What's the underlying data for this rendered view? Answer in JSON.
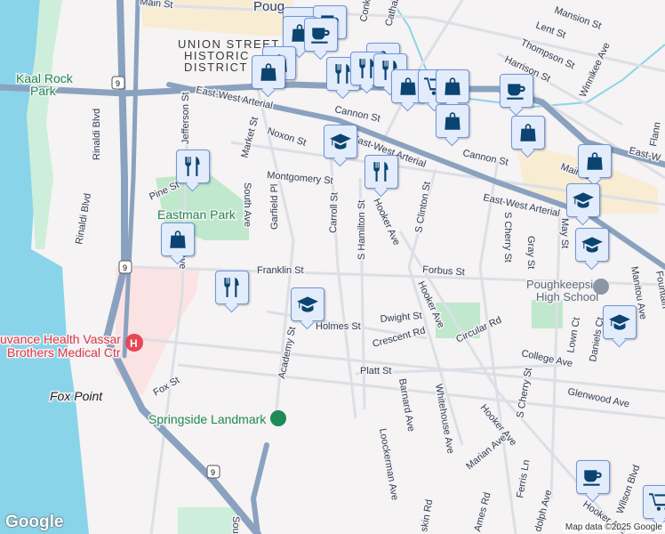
{
  "map": {
    "areas": {
      "district": [
        "UNION STREET",
        "HISTORIC",
        "DISTRICT"
      ],
      "city_partial": "Poug",
      "kaal_rock": [
        "Kaal Rock",
        "Park"
      ],
      "eastman": "Eastman Park",
      "hospital": [
        "uvance Health Vassar",
        "Brothers Medical Ctr"
      ],
      "fox_point": "Fox Point",
      "springside": "Springside Landmark",
      "high_school": [
        "Poughkeepsie",
        "High School"
      ]
    },
    "streets": {
      "main": "Main St",
      "main2": "Main St",
      "arterial1": "East-West Arterial",
      "arterial2": "East-West Arterial",
      "arterial3": "East-West Arterial",
      "arterial4": "East-W",
      "noxon": "Noxon St",
      "montgomery": "Montgomery St",
      "pine": "Pine St",
      "jefferson": "Jefferson St",
      "market": "Market St",
      "rinaldi1": "Rinaldi Blvd",
      "rinaldi2": "Rinaldi Blvd",
      "south_ave": "South Ave",
      "garfield": "Garfield Pl",
      "carroll": "Carroll St",
      "hamilton": "S Hamilton St",
      "hooker1": "Hooker Ave",
      "hooker2": "Hooker Ave",
      "hooker3": "Hooker Ave",
      "hooker4": "Hooker Ave",
      "clinton": "S Clinton St",
      "cannon1": "Cannon St",
      "cannon2": "Cannon St",
      "franklin": "Franklin St",
      "forbus": "Forbus St",
      "dwight": "Dwight St",
      "holmes": "Holmes St",
      "crescent": "Crescent Rd",
      "circular": "Circular Rd",
      "platt": "Platt St",
      "college": "College Ave",
      "glenwood": "Glenwood Ave",
      "barnard": "Barnard Ave",
      "whitehouse": "Whitehouse Ave",
      "loockerman": "Loockerman Ave",
      "marian": "Marian Ave",
      "ferris": "Ferris Ln",
      "academy": "Academy St",
      "fox": "Fox St",
      "cherry1": "S Cherry St",
      "cherry2": "S Cherry St",
      "gray": "Gray St",
      "may": "May St",
      "manitou": "Manitou Ave",
      "lown": "Lown Ct",
      "daniels": "Daniels Ct",
      "mansion": "Mansion St",
      "lent": "Lent St",
      "thompson": "Thompson St",
      "harrison": "Harrison St",
      "winnikee": "Winnikee Ave",
      "wilson": "Wilson Blvd",
      "conklin": "Conklin",
      "catharine": "Cathari",
      "fountain": "Fountain",
      "south_rd": "Sou",
      "randolph": "dolph Ave",
      "ames": "Ames Rd",
      "haskin": "skin Rd",
      "flann": "Flann",
      "jefferson_ave": "n Ave",
      "route": "9"
    },
    "markers": [
      {
        "type": "cafe",
        "icon": "coffee-cup-icon"
      },
      {
        "type": "cafe",
        "icon": "coffee-cup-icon"
      },
      {
        "type": "shopping",
        "icon": "shopping-bag-icon"
      },
      {
        "type": "cafe",
        "icon": "coffee-cup-icon"
      },
      {
        "type": "shopping",
        "icon": "shopping-bag-icon"
      },
      {
        "type": "shopping",
        "icon": "shopping-bag-icon"
      },
      {
        "type": "restaurant",
        "icon": "fork-knife-icon"
      },
      {
        "type": "shopping",
        "icon": "shopping-bag-icon"
      },
      {
        "type": "restaurant",
        "icon": "fork-knife-icon"
      },
      {
        "type": "restaurant",
        "icon": "fork-knife-icon"
      },
      {
        "type": "shopping",
        "icon": "shopping-bag-icon"
      },
      {
        "type": "grocery",
        "icon": "shopping-cart-icon"
      },
      {
        "type": "shopping",
        "icon": "shopping-bag-icon"
      },
      {
        "type": "shopping",
        "icon": "shopping-bag-icon"
      },
      {
        "type": "cafe",
        "icon": "coffee-cup-icon"
      },
      {
        "type": "shopping",
        "icon": "shopping-bag-icon"
      },
      {
        "type": "shopping",
        "icon": "shopping-bag-icon"
      },
      {
        "type": "school",
        "icon": "graduation-cap-icon"
      },
      {
        "type": "school",
        "icon": "graduation-cap-icon"
      },
      {
        "type": "school",
        "icon": "graduation-cap-icon"
      },
      {
        "type": "restaurant",
        "icon": "fork-knife-icon"
      },
      {
        "type": "shopping",
        "icon": "shopping-bag-icon"
      },
      {
        "type": "restaurant",
        "icon": "fork-knife-icon"
      },
      {
        "type": "school",
        "icon": "graduation-cap-icon"
      },
      {
        "type": "school",
        "icon": "graduation-cap-icon"
      },
      {
        "type": "restaurant",
        "icon": "fork-knife-icon"
      },
      {
        "type": "cafe",
        "icon": "coffee-cup-icon"
      },
      {
        "type": "grocery",
        "icon": "shopping-cart-icon"
      }
    ],
    "colors": {
      "water": "#8ad4ea",
      "highway": "#8aa2bf",
      "park": "#bfe8cc",
      "downtown": "#f8ecd2",
      "hospital": "#fbe3e3",
      "marker": "#0b4470"
    }
  },
  "branding": {
    "logo": "Google",
    "attribution": "Map data ©2025 Google"
  }
}
